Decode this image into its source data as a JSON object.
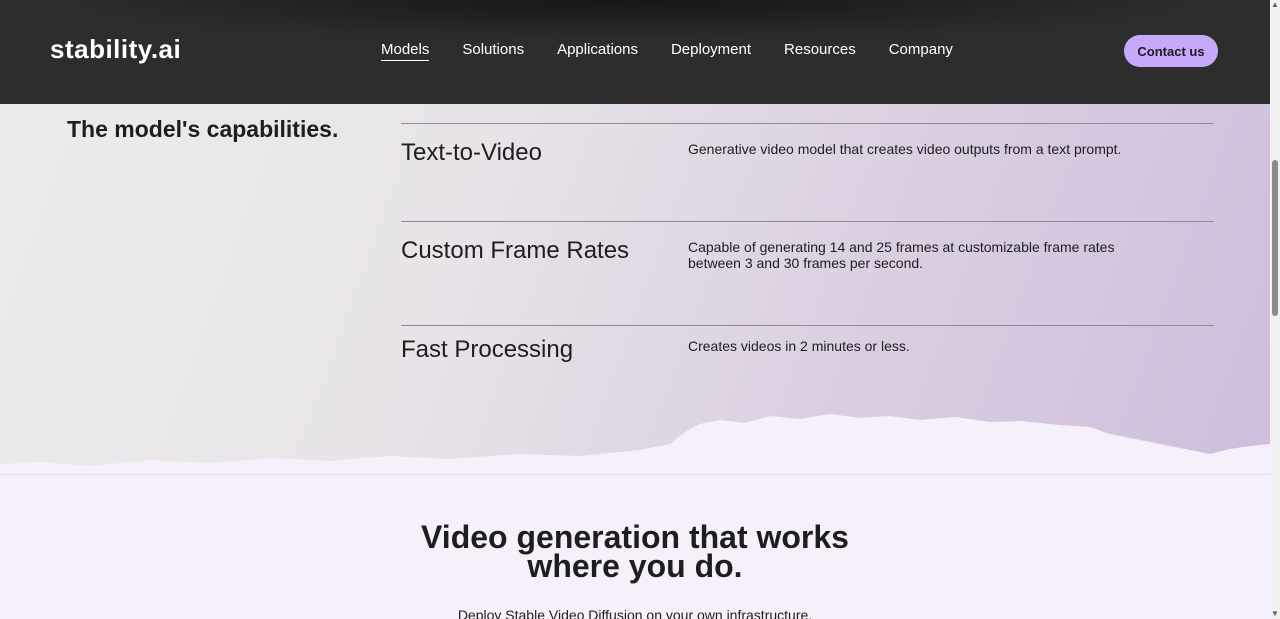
{
  "header": {
    "logo": "stability.ai",
    "nav": [
      "Models",
      "Solutions",
      "Applications",
      "Deployment",
      "Resources",
      "Company"
    ],
    "active_nav": "Models",
    "contact_label": "Contact us"
  },
  "capabilities": {
    "title": "The model's capabilities.",
    "items": [
      {
        "name": "Text-to-Video",
        "description": "Generative video model that creates video outputs from a text prompt."
      },
      {
        "name": "Custom Frame Rates",
        "description": "Capable of generating 14 and 25 frames at customizable frame rates between 3 and 30 frames per second."
      },
      {
        "name": "Fast Processing",
        "description": "Creates videos in 2 minutes or less."
      }
    ]
  },
  "deploy": {
    "title": "Video generation that works where you do.",
    "subtitle": "Deploy Stable Video Diffusion on your own infrastructure."
  },
  "colors": {
    "header_bg": "#2d2d2d",
    "accent": "#c7a9fb",
    "section_bg": "#f6f0fb"
  }
}
